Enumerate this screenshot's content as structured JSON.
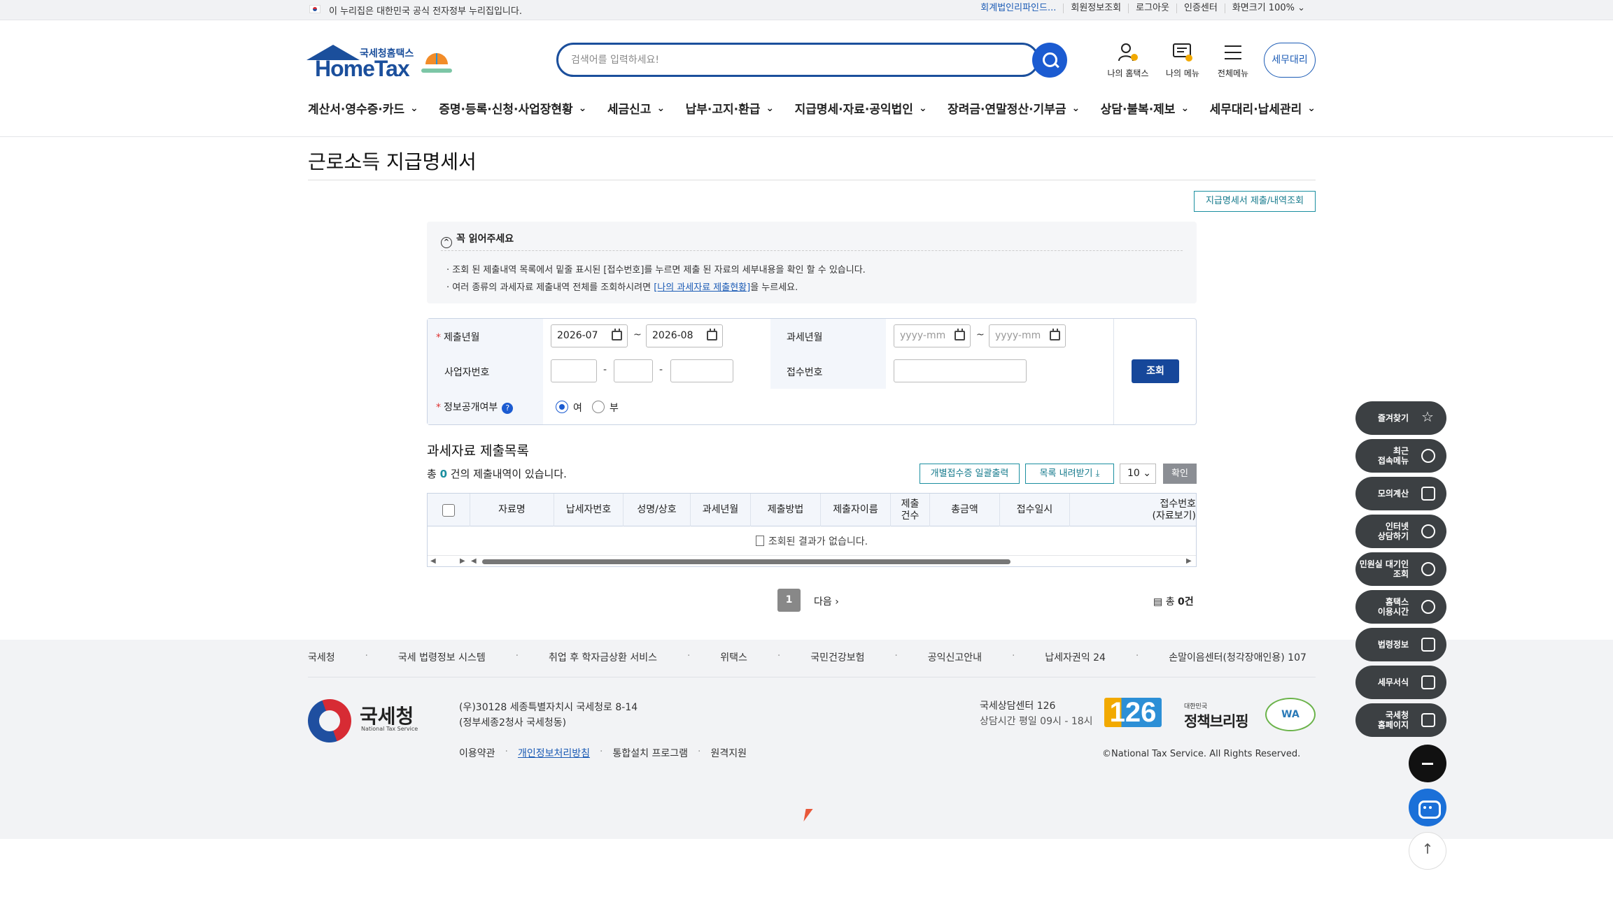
{
  "gov_banner": {
    "notice": "이 누리집은 대한민국 공식 전자정부 누리집입니다.",
    "links": [
      "회계법인리파인드...",
      "회원정보조회",
      "로그아웃",
      "인증센터",
      "화면크기 100% ⌄"
    ]
  },
  "header": {
    "logo_small": "국세청홈택스",
    "logo_big": "HomeTax",
    "search_placeholder": "검색어를 입력하세요!",
    "icons": [
      {
        "label": "나의 홈택스",
        "icon": "user-bell-icon"
      },
      {
        "label": "나의 메뉴",
        "icon": "user-menu-icon"
      },
      {
        "label": "전체메뉴",
        "icon": "hamburger-icon"
      }
    ],
    "tax_agent_button": "세무대리"
  },
  "nav": {
    "items": [
      "계산서·영수증·카드",
      "증명·등록·신청·사업장현황",
      "세금신고",
      "납부·고지·환급",
      "지급명세·자료·공익법인",
      "장려금·연말정산·기부금",
      "상담·불복·제보",
      "세무대리·납세관리"
    ]
  },
  "page": {
    "title": "근로소득 지급명세서",
    "submit_view_button": "지급명세서 제출/내역조회"
  },
  "notice": {
    "heading": "꼭 읽어주세요",
    "line1": "· 조회 된 제출내역 목록에서 밑줄 표시된 [접수번호]를 누르면 제출 된 자료의 세부내용을 확인 할 수 있습니다.",
    "line2_prefix": "· 여러 종류의 과세자료 제출내역 전체를 조회하시려면 ",
    "line2_link": "[나의 과세자료 제출현황]",
    "line2_suffix": "을 누르세요."
  },
  "form": {
    "submit_month_label": "제출년월",
    "submit_month_from": "2026-07",
    "submit_month_to": "2026-08",
    "tax_month_label": "과세년월",
    "tax_month_from_placeholder": "yyyy-mm",
    "tax_month_to_placeholder": "yyyy-mm",
    "biz_no_label": "사업자번호",
    "receipt_no_label": "접수번호",
    "disclosure_label": "정보공개여부",
    "help": "?",
    "radio_yes": "여",
    "radio_no": "부",
    "tilde": "~",
    "dash": "-",
    "required_mark": "*",
    "query_button": "조회"
  },
  "list": {
    "title": "과세자료 제출목록",
    "count_prefix": "총 ",
    "count": "0",
    "count_suffix": " 건의 제출내역이 있습니다.",
    "print_button": "개별접수증 일괄출력",
    "download_button": "목록 내려받기",
    "page_size": "10",
    "confirm_button": "확인",
    "columns": [
      "자료명",
      "납세자번호",
      "성명/상호",
      "과세년월",
      "제출방법",
      "제출자이름",
      "제출\n건수",
      "총금액",
      "접수일시",
      "접수번호\n(자료보기)"
    ],
    "empty_message": "조회된 결과가 없습니다."
  },
  "pagination": {
    "current": "1",
    "next": "다음",
    "total_prefix": "총 ",
    "total": "0건"
  },
  "footer": {
    "links": [
      "국세청",
      "국세 법령정보 시스템",
      "취업 후 학자금상환 서비스",
      "위택스",
      "국민건강보험",
      "공익신고안내",
      "납세자권익 24",
      "손말이음센터(청각장애인용) 107"
    ],
    "org_name": "국세청",
    "org_name_en": "National Tax Service",
    "address1": "(우)30128 세종특별자치시 국세청로 8-14",
    "address2": "(정부세종2청사 국세청동)",
    "sub_links": [
      "이용약관",
      "개인정보처리방침",
      "통합설치 프로그램",
      "원격지원"
    ],
    "center_title": "국세상담센터 126",
    "center_hours": "상담시간 평일 09시 - 18시",
    "badge_126": "126",
    "policy_small": "대한민국",
    "policy_big": "정책브리핑",
    "wa_mark": "WA",
    "copyright": "©National Tax Service. All Rights Reserved."
  },
  "quick_menu": [
    {
      "label": "즐겨찾기",
      "icon": "star-icon"
    },
    {
      "label": "최근\n접속메뉴",
      "icon": "clock-icon"
    },
    {
      "label": "모의계산",
      "icon": "calculator-icon"
    },
    {
      "label": "인터넷\n상담하기",
      "icon": "chat-icon"
    },
    {
      "label": "민원실 대기인\n조회",
      "icon": "person-search-icon"
    },
    {
      "label": "홈택스\n이용시간",
      "icon": "clock-icon"
    },
    {
      "label": "법령정보",
      "icon": "law-icon"
    },
    {
      "label": "세무서식",
      "icon": "form-icon"
    },
    {
      "label": "국세청\n홈페이지",
      "icon": "building-icon"
    }
  ]
}
